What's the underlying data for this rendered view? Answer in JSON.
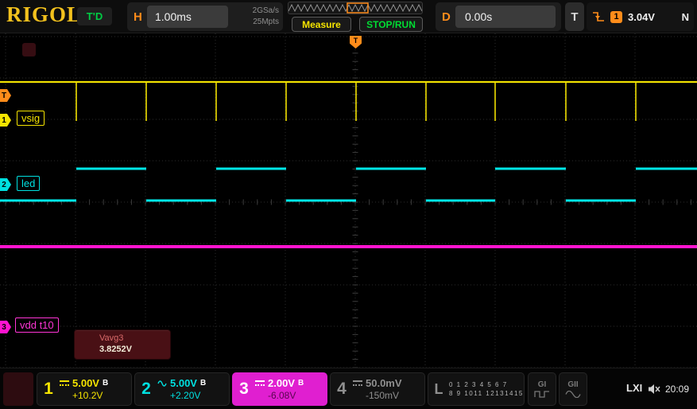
{
  "header": {
    "brand": "RIGOL",
    "trig_status": "T'D",
    "h_label": "H",
    "timebase": "1.00ms",
    "sample_rate": "2GSa/s",
    "mem_depth": "25Mpts",
    "measure_btn": "Measure",
    "stoprun_btn": "STOP/RUN",
    "d_label": "D",
    "delay": "0.00s",
    "t_label": "T",
    "trig_source": "1",
    "trig_level": "3.04V",
    "trig_mode": "N"
  },
  "display": {
    "ch1_label": "vsig",
    "ch2_label": "led",
    "ch3_label": "vdd t10",
    "trig_pos_label": "T",
    "marker_t": "T",
    "marker_1": "1",
    "marker_2": "2",
    "marker_3": "3",
    "measure_popup": {
      "name": "Vavg3",
      "value": "3.8252V"
    }
  },
  "footer": {
    "channels": [
      {
        "num": "1",
        "scale": "5.00V",
        "bw": "B",
        "offset": "+10.2V"
      },
      {
        "num": "2",
        "scale": "5.00V",
        "bw": "B",
        "offset": "+2.20V"
      },
      {
        "num": "3",
        "scale": "2.00V",
        "bw": "B",
        "offset": "-6.08V"
      },
      {
        "num": "4",
        "scale": "50.0mV",
        "bw": "",
        "offset": "-150mV"
      }
    ],
    "digital_label": "L",
    "digital_row1": "0 1 2 3 4 5 6 7",
    "digital_row2": "8 9 1011 12131415",
    "gen1_label": "GI",
    "gen2_label": "GII",
    "lxi_label": "LXI",
    "clock": "20:09"
  },
  "colors": {
    "ch1": "#f5e400",
    "ch2": "#00e8e8",
    "ch3": "#ff14d0",
    "ch4": "#8f8f8f",
    "trigger": "#ff8c1a",
    "run_green": "#00dd33",
    "brand_gold": "#f2c11d"
  },
  "chart_data": {
    "type": "line",
    "x_units": "time, 1.00ms/div, 10 divs of 88px",
    "y_units": "volts per channel scale in footer",
    "series": [
      {
        "name": "vsig (CH1)",
        "color": "#f0e000",
        "shape": "baseline-with-spikes",
        "baseline_y": 61,
        "spike_bottom_y": 110,
        "spike_xs": [
          96,
          184,
          272,
          360,
          448,
          536,
          623,
          712,
          800
        ]
      },
      {
        "name": "led (CH2)",
        "color": "#00e8e8",
        "shape": "square",
        "high_y": 170,
        "low_y": 210,
        "start_level": "low",
        "edge_xs": [
          96,
          184,
          272,
          360,
          448,
          536,
          623,
          712,
          800
        ]
      },
      {
        "name": "vdd (CH3)",
        "color": "#ff14d0",
        "shape": "flat",
        "y": 268
      }
    ]
  }
}
